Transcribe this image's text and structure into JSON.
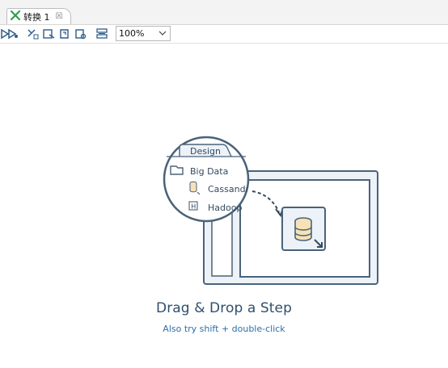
{
  "tab": {
    "label": "转换 1",
    "close": "☒"
  },
  "toolbar": {
    "buttons": [
      "run-icon",
      "pause-icon",
      "preview-icon",
      "debug-icon",
      "replay-icon",
      "impact-icon",
      "sql-icon"
    ],
    "zoom_value": "100%"
  },
  "illustration": {
    "design_tab": "Design",
    "folder_label": "Big Data",
    "items": [
      "Cassandra",
      "Hadoop"
    ]
  },
  "empty_state": {
    "title": "Drag & Drop a Step",
    "subtitle": "Also try shift + double-click"
  },
  "colors": {
    "accent": "#34495e",
    "stroke": "#4a6279",
    "panel_fill": "#ecf2f8",
    "sub_text": "#2c6fab"
  }
}
